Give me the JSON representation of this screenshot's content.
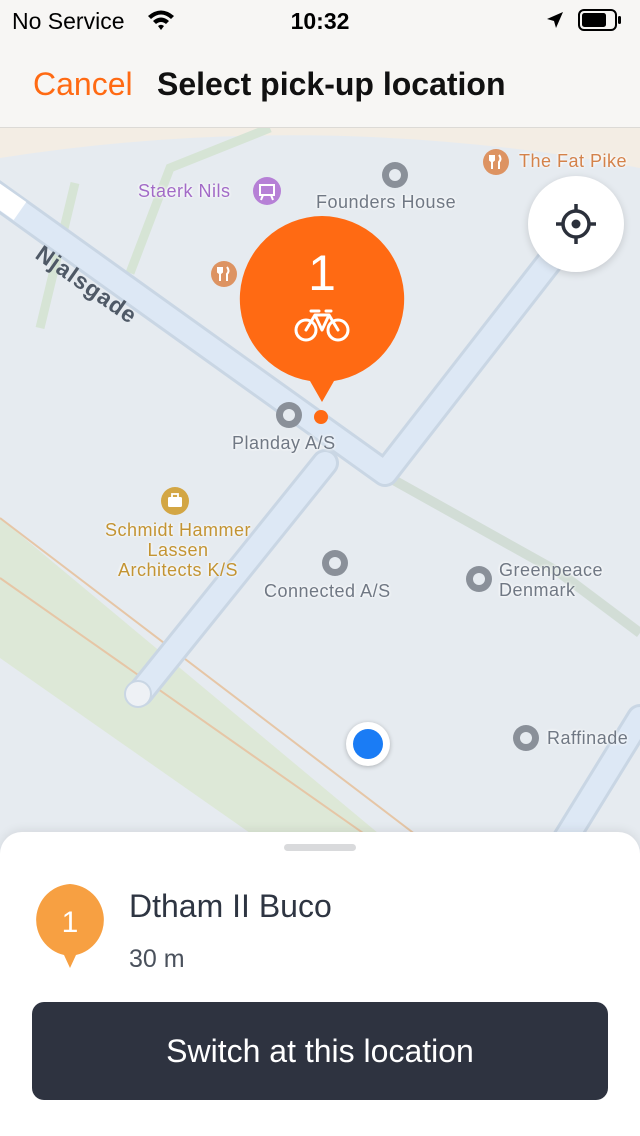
{
  "status_bar": {
    "carrier": "No Service",
    "time": "10:32",
    "icons": [
      "wifi-icon",
      "location-arrow-icon",
      "battery-icon"
    ]
  },
  "nav": {
    "cancel_label": "Cancel",
    "title": "Select pick-up location"
  },
  "map": {
    "street_label": "Njalsgade",
    "pois": [
      {
        "name": "Staerk Nils",
        "icon": "gallery-icon",
        "color": "#a26bc7"
      },
      {
        "name": "Founders House",
        "icon": "place-icon",
        "color": "#707884"
      },
      {
        "name": "The Fat Pike",
        "icon": "restaurant-icon",
        "color": "#d4824a"
      },
      {
        "name": "Planday A/S",
        "icon": "place-icon",
        "color": "#707884"
      },
      {
        "name": "Schmidt Hammer\nLassen\nArchitects K/S",
        "icon": "briefcase-icon",
        "color": "#c39433"
      },
      {
        "name": "Connected A/S",
        "icon": "place-icon",
        "color": "#707884"
      },
      {
        "name": "Greenpeace\nDenmark",
        "icon": "place-icon",
        "color": "#707884"
      },
      {
        "name": "Raffinade",
        "icon": "place-icon",
        "color": "#707884"
      }
    ],
    "marker": {
      "count": "1",
      "icon": "bicycle-icon",
      "color": "#ff6a13"
    }
  },
  "sheet": {
    "pin_number": "1",
    "pin_color": "#f7a042",
    "location_name": "Dtham II Buco",
    "distance": "30 m",
    "action_label": "Switch at this location"
  },
  "colors": {
    "accent": "#ff6a13",
    "button_dark": "#2e3340",
    "user_location": "#1a7cf5"
  }
}
